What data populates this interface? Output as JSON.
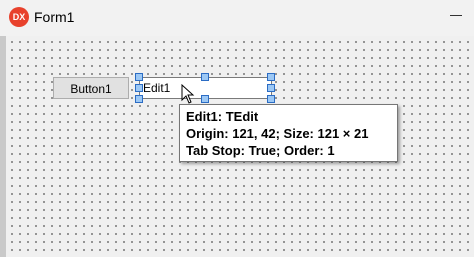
{
  "window": {
    "app_icon_text": "DX",
    "title": "Form1"
  },
  "controls": {
    "button1_label": "Button1",
    "edit1_text": "Edit1"
  },
  "hint": {
    "line1": "Edit1: TEdit",
    "line2": "Origin: 121, 42; Size: 121 × 21",
    "line3": "Tab Stop: True; Order: 1"
  },
  "colors": {
    "app_icon": "#e8412c",
    "selection_handle": "#9cc8f5"
  }
}
